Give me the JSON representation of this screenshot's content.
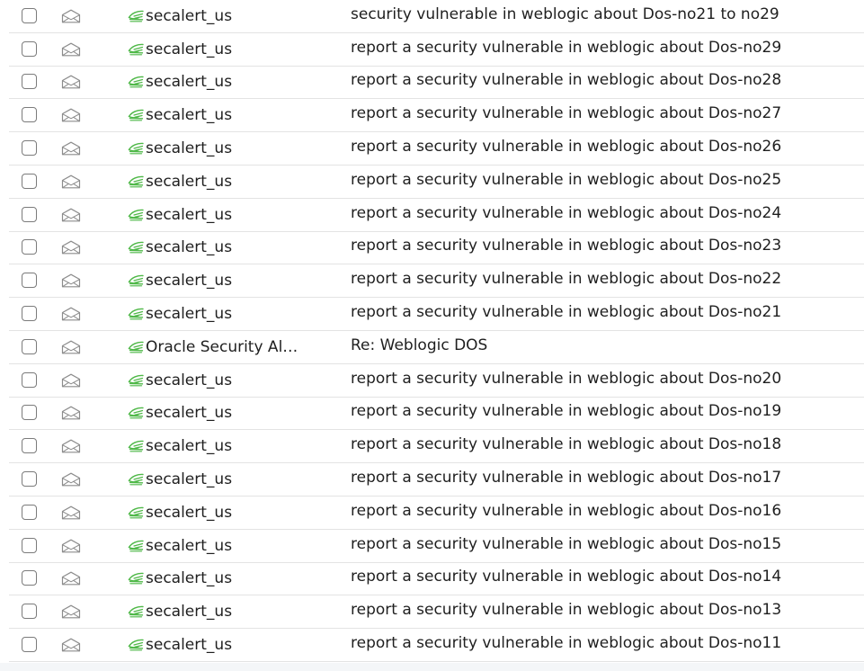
{
  "messages": [
    {
      "sender": "secalert_us",
      "subject": "security vulnerable in weblogic about Dos-no21 to no29"
    },
    {
      "sender": "secalert_us",
      "subject": "report a security vulnerable in weblogic about Dos-no29"
    },
    {
      "sender": "secalert_us",
      "subject": "report a security vulnerable in weblogic about Dos-no28"
    },
    {
      "sender": "secalert_us",
      "subject": "report a security vulnerable in weblogic about Dos-no27"
    },
    {
      "sender": "secalert_us",
      "subject": "report a security vulnerable in weblogic about Dos-no26"
    },
    {
      "sender": "secalert_us",
      "subject": "report a security vulnerable in weblogic about Dos-no25"
    },
    {
      "sender": "secalert_us",
      "subject": "report a security vulnerable in weblogic about Dos-no24"
    },
    {
      "sender": "secalert_us",
      "subject": "report a security vulnerable in weblogic about Dos-no23"
    },
    {
      "sender": "secalert_us",
      "subject": "report a security vulnerable in weblogic about Dos-no22"
    },
    {
      "sender": "secalert_us",
      "subject": "report a security vulnerable in weblogic about Dos-no21"
    },
    {
      "sender": "Oracle Security Al…",
      "subject": "Re: Weblogic DOS"
    },
    {
      "sender": "secalert_us",
      "subject": "report a security vulnerable in weblogic about Dos-no20"
    },
    {
      "sender": "secalert_us",
      "subject": "report a security vulnerable in weblogic about Dos-no19"
    },
    {
      "sender": "secalert_us",
      "subject": "report a security vulnerable in weblogic about Dos-no18"
    },
    {
      "sender": "secalert_us",
      "subject": "report a security vulnerable in weblogic about Dos-no17"
    },
    {
      "sender": "secalert_us",
      "subject": "report a security vulnerable in weblogic about Dos-no16"
    },
    {
      "sender": "secalert_us",
      "subject": "report a security vulnerable in weblogic about Dos-no15"
    },
    {
      "sender": "secalert_us",
      "subject": "report a security vulnerable in weblogic about Dos-no14"
    },
    {
      "sender": "secalert_us",
      "subject": "report a security vulnerable in weblogic about Dos-no13"
    },
    {
      "sender": "secalert_us",
      "subject": "report a security vulnerable in weblogic about Dos-no11"
    }
  ],
  "icons": {
    "row_checkbox": "checkbox-icon",
    "read_status": "envelope-open-icon",
    "sender_badge": "green-feather-icon"
  },
  "colors": {
    "sender_badge": "#4fb848",
    "envelope": "#8c8c8c",
    "separator": "#e3e3e3"
  }
}
